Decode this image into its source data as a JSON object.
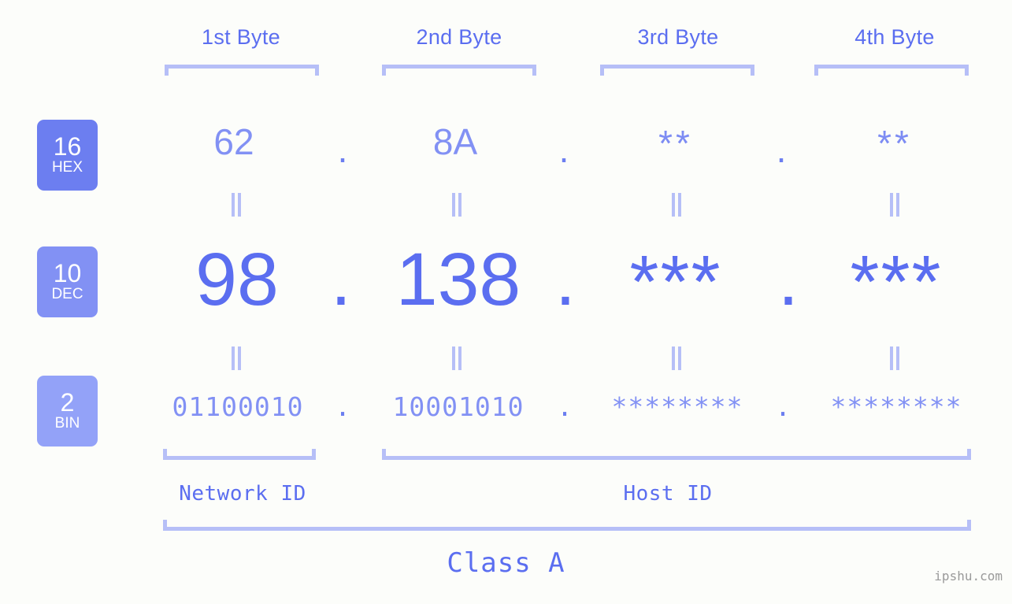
{
  "background_color": "#fcfdfa",
  "accent_colors": {
    "strong": "#5b6ef0",
    "mid": "#8291f4",
    "light": "#b6bff7",
    "badge_hex": "#6c7ef0",
    "badge_dec": "#8291f4",
    "badge_bin": "#93a2f8",
    "watermark": "#9a9a9a"
  },
  "header": {
    "bytes": [
      {
        "label": "1st Byte"
      },
      {
        "label": "2nd Byte"
      },
      {
        "label": "3rd Byte"
      },
      {
        "label": "4th Byte"
      }
    ]
  },
  "bases": [
    {
      "number": "16",
      "name": "HEX"
    },
    {
      "number": "10",
      "name": "DEC"
    },
    {
      "number": "2",
      "name": "BIN"
    }
  ],
  "rows": {
    "hex": {
      "values": [
        "62",
        "8A",
        "**",
        "**"
      ],
      "separators": [
        ".",
        ".",
        "."
      ]
    },
    "dec": {
      "values": [
        "98",
        "138",
        "***",
        "***"
      ],
      "separators": [
        ".",
        ".",
        "."
      ]
    },
    "bin": {
      "values": [
        "01100010",
        "10001010",
        "********",
        "********"
      ],
      "separators": [
        ".",
        ".",
        "."
      ]
    }
  },
  "equality_marks": {
    "symbol": "=",
    "count_per_row": 4,
    "rows": 2
  },
  "footer": {
    "network_id_label": "Network ID",
    "host_id_label": "Host ID",
    "class_label": "Class A"
  },
  "watermark": {
    "text": "ipshu.com"
  }
}
